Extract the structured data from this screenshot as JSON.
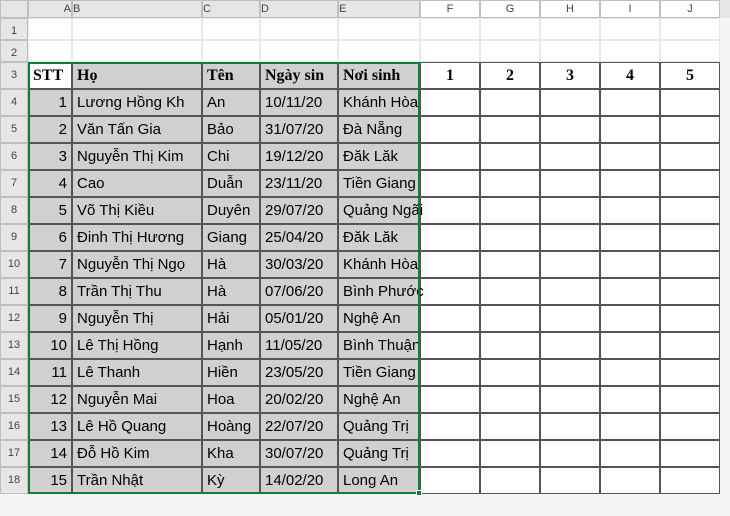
{
  "columns": [
    "A",
    "B",
    "C",
    "D",
    "E",
    "F",
    "G",
    "H",
    "I",
    "J"
  ],
  "row_numbers": [
    1,
    2,
    3,
    4,
    5,
    6,
    7,
    8,
    9,
    10,
    11,
    12,
    13,
    14,
    15,
    16,
    17,
    18
  ],
  "header": {
    "A": "STT",
    "B": "Họ",
    "C": "Tên",
    "D": "Ngày sin",
    "E": "Nơi sinh",
    "F": "1",
    "G": "2",
    "H": "3",
    "I": "4",
    "J": "5"
  },
  "rows": [
    {
      "stt": "1",
      "ho": "Lương Hồng Kh",
      "ten": "An",
      "ngay": "10/11/20",
      "noi": "Khánh Hòa"
    },
    {
      "stt": "2",
      "ho": "Văn Tấn Gia",
      "ten": "Bảo",
      "ngay": "31/07/20",
      "noi": "Đà Nẵng"
    },
    {
      "stt": "3",
      "ho": "Nguyễn Thị Kim",
      "ten": "Chi",
      "ngay": "19/12/20",
      "noi": "Đăk Lăk"
    },
    {
      "stt": "4",
      "ho": "Cao",
      "ten": "Duẫn",
      "ngay": "23/11/20",
      "noi": "Tiền Giang"
    },
    {
      "stt": "5",
      "ho": "Võ Thị Kiều",
      "ten": "Duyên",
      "ngay": "29/07/20",
      "noi": "Quảng Ngãi"
    },
    {
      "stt": "6",
      "ho": "Đinh Thị Hương",
      "ten": "Giang",
      "ngay": "25/04/20",
      "noi": "Đăk Lăk"
    },
    {
      "stt": "7",
      "ho": "Nguyễn Thị Ngọ",
      "ten": "Hà",
      "ngay": "30/03/20",
      "noi": "Khánh Hòa"
    },
    {
      "stt": "8",
      "ho": "Trần Thị Thu",
      "ten": "Hà",
      "ngay": "07/06/20",
      "noi": "Bình Phước"
    },
    {
      "stt": "9",
      "ho": "Nguyễn Thị",
      "ten": "Hải",
      "ngay": "05/01/20",
      "noi": "Nghệ An"
    },
    {
      "stt": "10",
      "ho": "Lê Thị Hồng",
      "ten": "Hạnh",
      "ngay": "11/05/20",
      "noi": "Bình Thuận"
    },
    {
      "stt": "11",
      "ho": "Lê Thanh",
      "ten": "Hiền",
      "ngay": "23/05/20",
      "noi": "Tiền Giang"
    },
    {
      "stt": "12",
      "ho": "Nguyễn Mai",
      "ten": "Hoa",
      "ngay": "20/02/20",
      "noi": "Nghệ An"
    },
    {
      "stt": "13",
      "ho": "Lê Hồ Quang",
      "ten": "Hoàng",
      "ngay": "22/07/20",
      "noi": "Quảng Trị"
    },
    {
      "stt": "14",
      "ho": "Đỗ Hồ Kim",
      "ten": "Kha",
      "ngay": "30/07/20",
      "noi": "Quảng Trị"
    },
    {
      "stt": "15",
      "ho": "Trần Nhật",
      "ten": "Kỳ",
      "ngay": "14/02/20",
      "noi": "Long An"
    }
  ]
}
